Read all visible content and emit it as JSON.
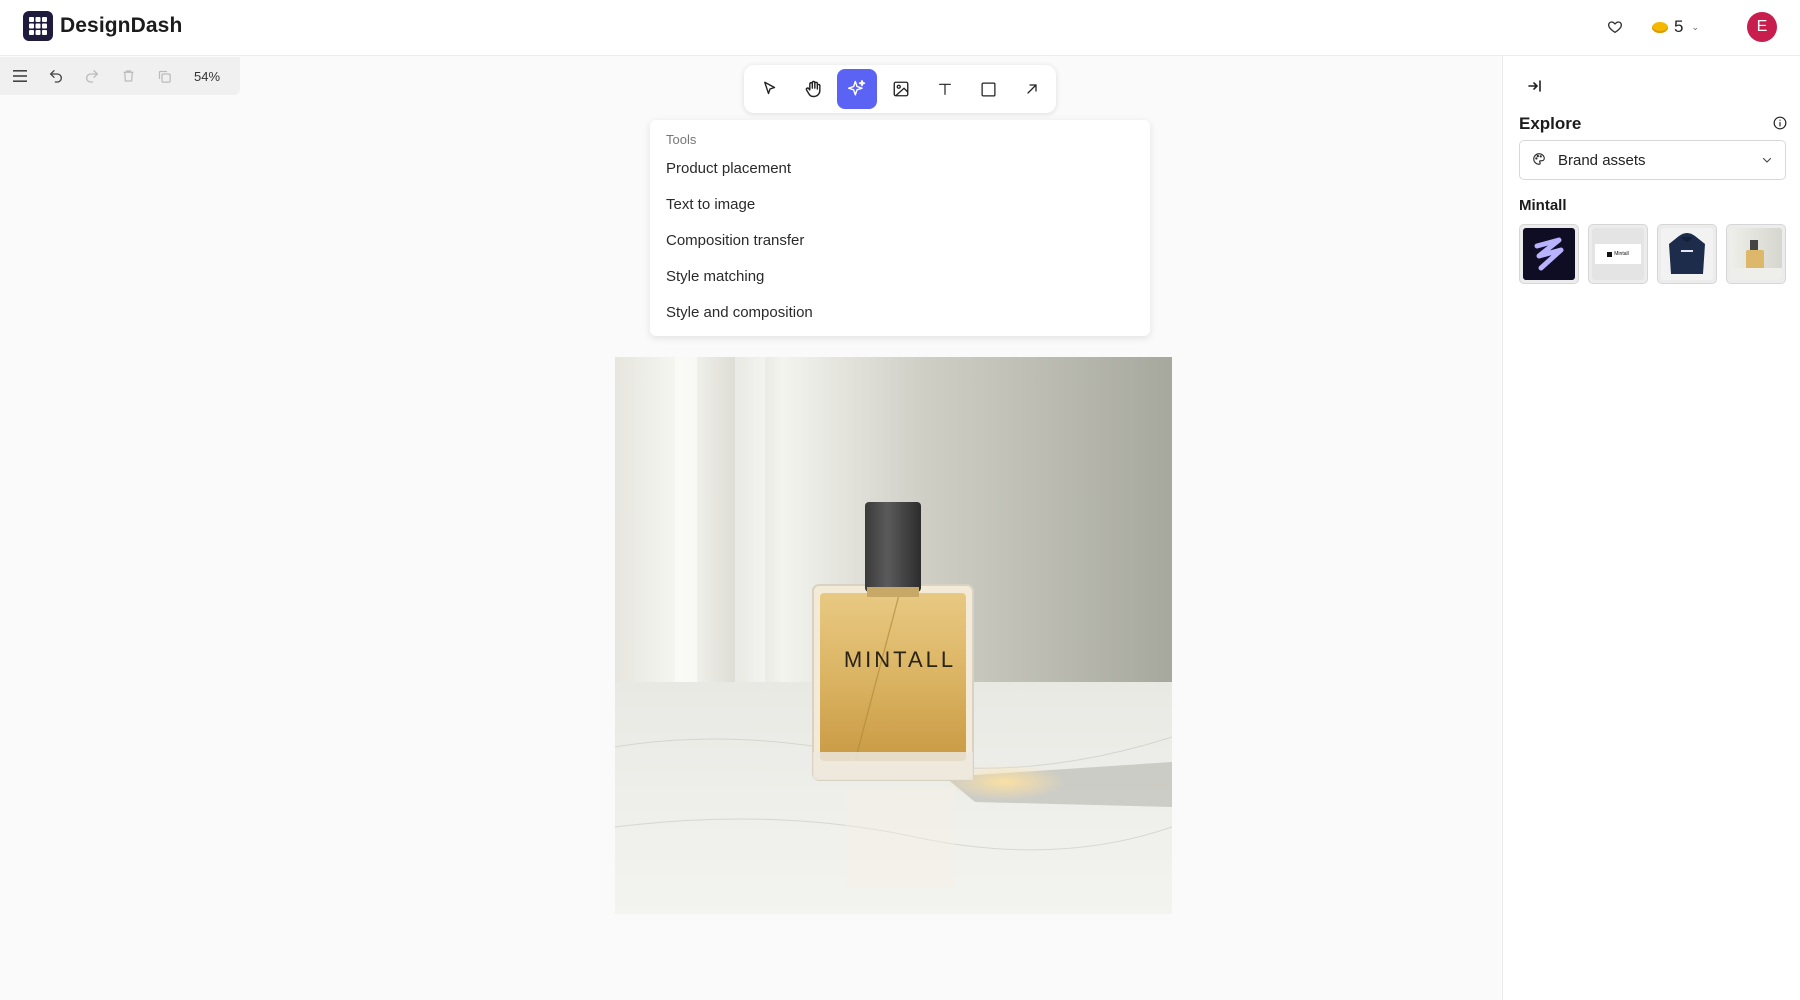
{
  "app": {
    "title": "DesignDash",
    "credits": "5",
    "avatar_initial": "E"
  },
  "mini_toolbar": {
    "zoom": "54%"
  },
  "tools_menu": {
    "header": "Tools",
    "items": [
      "Product placement",
      "Text to image",
      "Composition transfer",
      "Style matching",
      "Style and composition"
    ]
  },
  "canvas": {
    "product_label": "MINTALL"
  },
  "right_panel": {
    "explore_title": "Explore",
    "selected_source": "Brand assets",
    "brand_name": "Mintall",
    "thumb_logo_text": "Mintall"
  },
  "colors": {
    "accent": "#5b63f5",
    "avatar": "#c81e4e",
    "coin": "#f5b800",
    "logo": "#1f1b3d"
  }
}
